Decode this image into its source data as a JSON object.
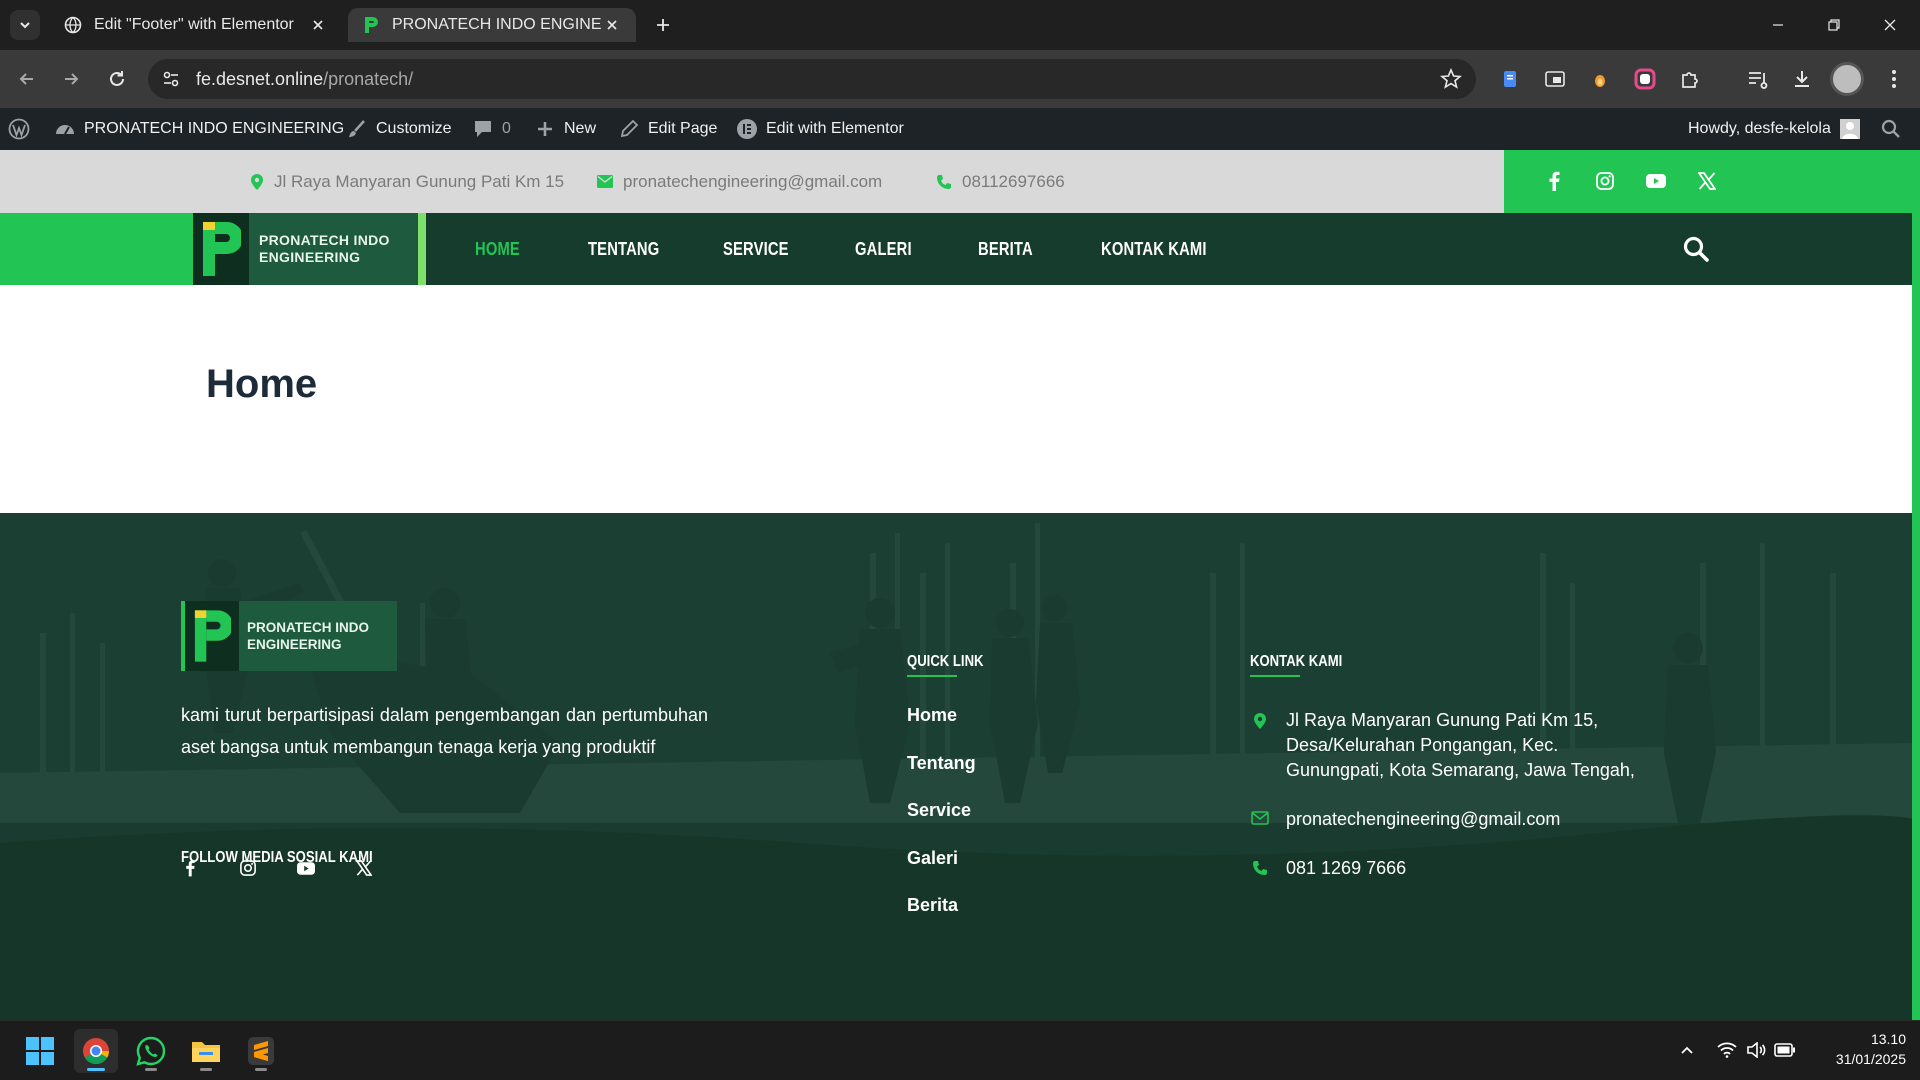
{
  "browser": {
    "tabs": [
      {
        "title": "Edit \"Footer\" with Elementor",
        "active": false
      },
      {
        "title": "PRONATECH INDO ENGINEERING",
        "active": true
      }
    ],
    "url_host": "fe.desnet.online",
    "url_path": "/pronatech/"
  },
  "adminbar": {
    "site_name": "PRONATECH INDO ENGINEERING",
    "customize": "Customize",
    "comments_count": "0",
    "new": "New",
    "edit_page": "Edit Page",
    "edit_elementor": "Edit with Elementor",
    "howdy": "Howdy, desfe-kelola"
  },
  "topbar": {
    "address": "Jl Raya Manyaran Gunung Pati Km 15",
    "email": "pronatechengineering@gmail.com",
    "phone": "08112697666"
  },
  "logo": {
    "line1": "PRONATECH INDO",
    "line2": "ENGINEERING"
  },
  "nav": {
    "items": [
      "HOME",
      "TENTANG",
      "SERVICE",
      "GALERI",
      "BERITA",
      "KONTAK KAMI"
    ],
    "active": "HOME"
  },
  "page": {
    "title": "Home"
  },
  "footer": {
    "about": "kami turut berpartisipasi dalam pengembangan dan pertumbuhan aset bangsa untuk membangun tenaga kerja yang produktif",
    "follow_heading": "FOLLOW MEDIA SOSIAL KAMI",
    "quick_link_heading": "QUICK LINK",
    "quick_links": [
      "Home",
      "Tentang",
      "Service",
      "Galeri",
      "Berita"
    ],
    "contact_heading": "KONTAK KAMI",
    "contact_address": "Jl Raya Manyaran Gunung Pati Km 15, Desa/Kelurahan Pongangan, Kec. Gunungpati, Kota Semarang, Jawa Tengah,",
    "contact_email": "pronatechengineering@gmail.com",
    "contact_phone": "081 1269 7666"
  },
  "taskbar": {
    "time": "13.10",
    "date": "31/01/2025"
  },
  "colors": {
    "brand_green": "#22c553",
    "nav_dark": "#163c2d",
    "footer_bg": "#1c3f33"
  },
  "icons": {
    "social": [
      "facebook-icon",
      "instagram-icon",
      "youtube-icon",
      "x-icon"
    ],
    "contact": [
      "map-pin-icon",
      "envelope-icon",
      "phone-icon"
    ]
  }
}
